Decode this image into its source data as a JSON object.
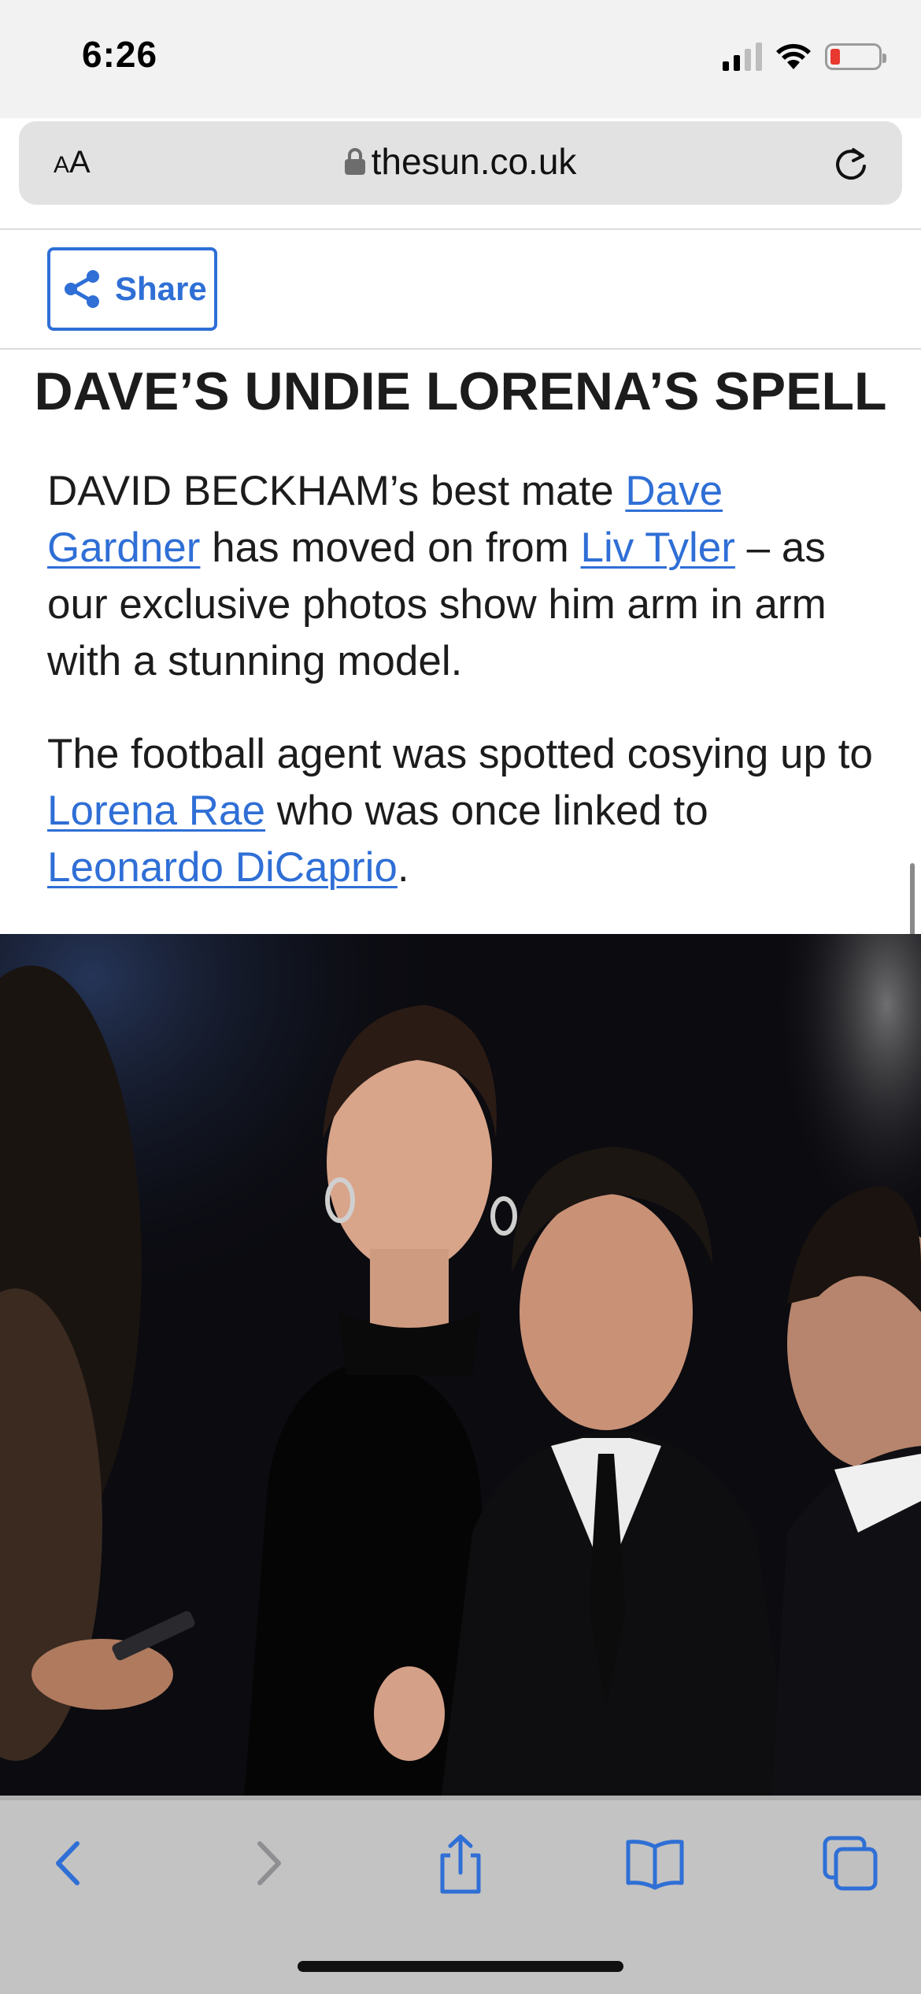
{
  "status_bar": {
    "time": "6:26",
    "battery_level": 0.1,
    "battery_color": "#e8382f",
    "signal_bars": 2
  },
  "browser": {
    "reader_label_small": "A",
    "reader_label_large": "A",
    "url": "thesun.co.uk",
    "lock_icon": "lock-icon",
    "reload_icon": "reload-icon"
  },
  "share": {
    "label": "Share",
    "icon": "share-icon"
  },
  "article": {
    "headline": "DAVE’S UNDIE LORENA’S SPELL",
    "para1": {
      "t1": "DAVID BECKHAM’s best mate ",
      "link1": "Dave Gardner",
      "t2": " has moved on from ",
      "link2": "Liv Tyler",
      "t3": " – as our exclusive photos show him arm in arm with a stunning model."
    },
    "para2": {
      "t1": "The football agent was spotted cosying up to ",
      "link1": "Lorena Rae",
      "t2": " who was once linked to ",
      "link2": "Leonardo DiCaprio",
      "t3": "."
    }
  },
  "toolbar": {
    "items": [
      "back-icon",
      "forward-icon",
      "share-icon",
      "bookmarks-icon",
      "tabs-icon"
    ]
  },
  "colors": {
    "link": "#2f6fd6",
    "text": "#1c1c1c",
    "toolbar_icon": "#2f6fd6",
    "toolbar_icon_disabled": "#8e8e93"
  }
}
